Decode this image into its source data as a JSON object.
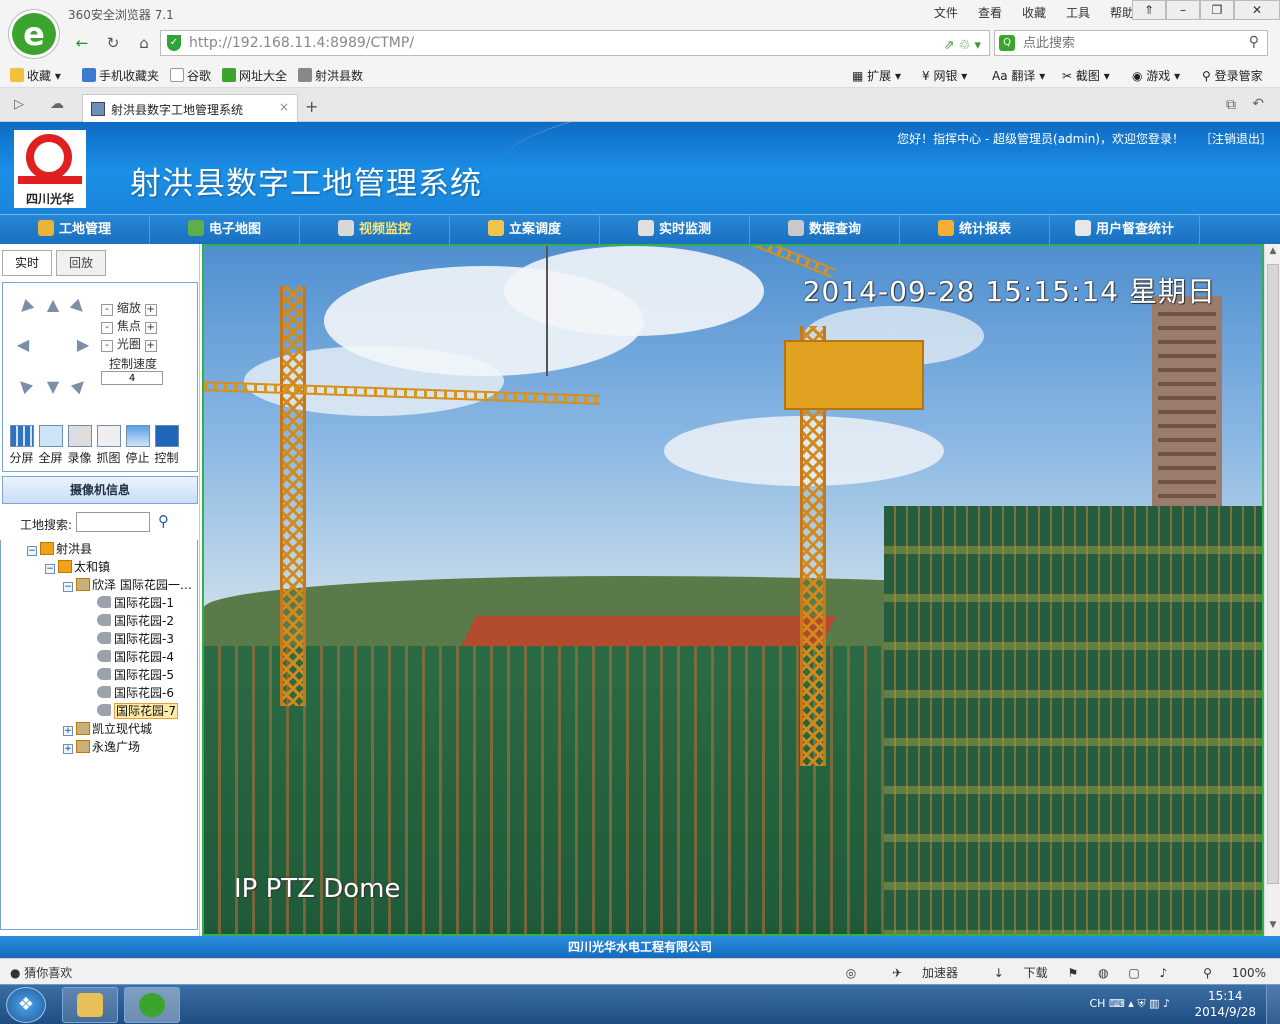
{
  "browser": {
    "title": "360安全浏览器 7.1",
    "menu": [
      "文件",
      "查看",
      "收藏",
      "工具",
      "帮助"
    ],
    "url_host": "http://192.168.11.4",
    "url_rest": ":8989/CTMP/",
    "search_placeholder": "点此搜索",
    "favorites": [
      "收藏",
      "手机收藏夹",
      "谷歌",
      "网址大全",
      "射洪县数"
    ],
    "toolbar_right": [
      "扩展",
      "网银",
      "翻译",
      "截图",
      "游戏",
      "登录管家"
    ],
    "tab_title": "射洪县数字工地管理系统",
    "tab_close": "×",
    "tab_new": "+"
  },
  "site": {
    "logo_text": "四川光华",
    "title": "射洪县数字工地管理系统",
    "welcome": "您好！指挥中心 - 超级管理员(admin)，欢迎您登录！",
    "logout": "［注销退出］",
    "nav": [
      {
        "label": "工地管理",
        "color": "#e9b43a"
      },
      {
        "label": "电子地图",
        "color": "#5fae4e"
      },
      {
        "label": "视频监控",
        "color": "#d8d8d8"
      },
      {
        "label": "立案调度",
        "color": "#f0c450"
      },
      {
        "label": "实时监测",
        "color": "#e0e0e0"
      },
      {
        "label": "数据查询",
        "color": "#c9c9c9"
      },
      {
        "label": "统计报表",
        "color": "#f2b134"
      },
      {
        "label": "用户督查统计",
        "color": "#e7e7e7"
      }
    ],
    "footer": "四川光华水电工程有限公司"
  },
  "panel": {
    "tabs": [
      "实时",
      "回放"
    ],
    "zoom": "缩放",
    "focus": "焦点",
    "iris": "光圈",
    "minus": "-",
    "plus": "+",
    "speed_label": "控制速度",
    "speed_value": "4",
    "tools": [
      "分屏",
      "全屏",
      "录像",
      "抓图",
      "停止",
      "控制"
    ],
    "cam_info": "摄像机信息",
    "site_search_label": "工地搜索:",
    "tree": {
      "root": "射洪县",
      "town": "太和镇",
      "project": "欣泽 国际花园一…",
      "cameras": [
        "国际花园-1",
        "国际花园-2",
        "国际花园-3",
        "国际花园-4",
        "国际花园-5",
        "国际花园-6",
        "国际花园-7"
      ],
      "others": [
        "凯立现代城",
        "永逸广场"
      ],
      "exp_open": "−",
      "exp_closed": "+"
    }
  },
  "video": {
    "timestamp": "2014-09-28 15:15:14 星期日",
    "camera_label": "IP PTZ Dome"
  },
  "statusbar": {
    "left": "猜你喜欢",
    "right": [
      "加速器",
      "下载",
      "100%"
    ]
  },
  "taskbar": {
    "lang": "CH",
    "time": "15:14",
    "date": "2014/9/28"
  }
}
